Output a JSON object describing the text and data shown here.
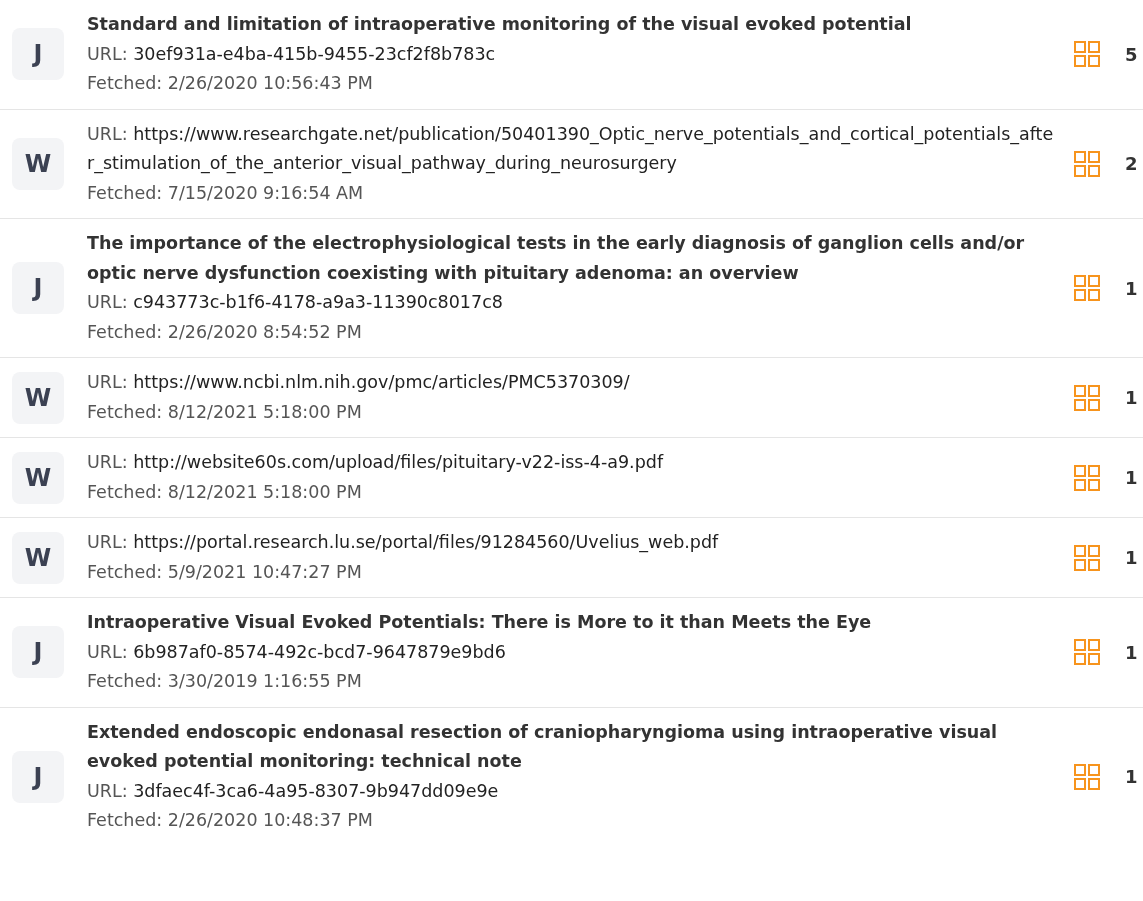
{
  "sources": [
    {
      "type": "J",
      "title": "Standard and limitation of intraoperative monitoring of the visual evoked potential",
      "url_label": "URL:",
      "url": "30ef931a-e4ba-415b-9455-23cf2f8b783c",
      "fetched": "Fetched: 2/26/2020 10:56:43 PM",
      "count": "5"
    },
    {
      "type": "W",
      "url_label": "URL:",
      "url": "https://www.researchgate.net/publication/50401390_Optic_nerve_potentials_and_cortical_potentials_after_stimulation_of_the_anterior_visual_pathway_during_neurosurgery",
      "fetched": "Fetched: 7/15/2020 9:16:54 AM",
      "count": "2"
    },
    {
      "type": "J",
      "title": "The importance of the electrophysiological tests in the early diagnosis of ganglion cells and/or optic nerve dysfunction coexisting with pituitary adenoma: an overview",
      "url_label": "URL:",
      "url": "c943773c-b1f6-4178-a9a3-11390c8017c8",
      "fetched": "Fetched: 2/26/2020 8:54:52 PM",
      "count": "1"
    },
    {
      "type": "W",
      "url_label": "URL:",
      "url": "https://www.ncbi.nlm.nih.gov/pmc/articles/PMC5370309/",
      "fetched": "Fetched: 8/12/2021 5:18:00 PM",
      "count": "1"
    },
    {
      "type": "W",
      "url_label": "URL:",
      "url": "http://website60s.com/upload/files/pituitary-v22-iss-4-a9.pdf",
      "fetched": "Fetched: 8/12/2021 5:18:00 PM",
      "count": "1"
    },
    {
      "type": "W",
      "url_label": "URL:",
      "url": "https://portal.research.lu.se/portal/files/91284560/Uvelius_web.pdf",
      "fetched": "Fetched: 5/9/2021 10:47:27 PM",
      "count": "1"
    },
    {
      "type": "J",
      "title": "Intraoperative Visual Evoked Potentials: There is More to it than Meets the Eye",
      "url_label": "URL:",
      "url": "6b987af0-8574-492c-bcd7-9647879e9bd6",
      "fetched": "Fetched: 3/30/2019 1:16:55 PM",
      "count": "1"
    },
    {
      "type": "J",
      "title": "Extended endoscopic endonasal resection of craniopharyngioma using intraoperative visual evoked potential monitoring: technical note",
      "url_label": "URL:",
      "url": "3dfaec4f-3ca6-4a95-8307-9b947dd09e9e",
      "fetched": "Fetched: 2/26/2020 10:48:37 PM",
      "count": "1"
    }
  ]
}
